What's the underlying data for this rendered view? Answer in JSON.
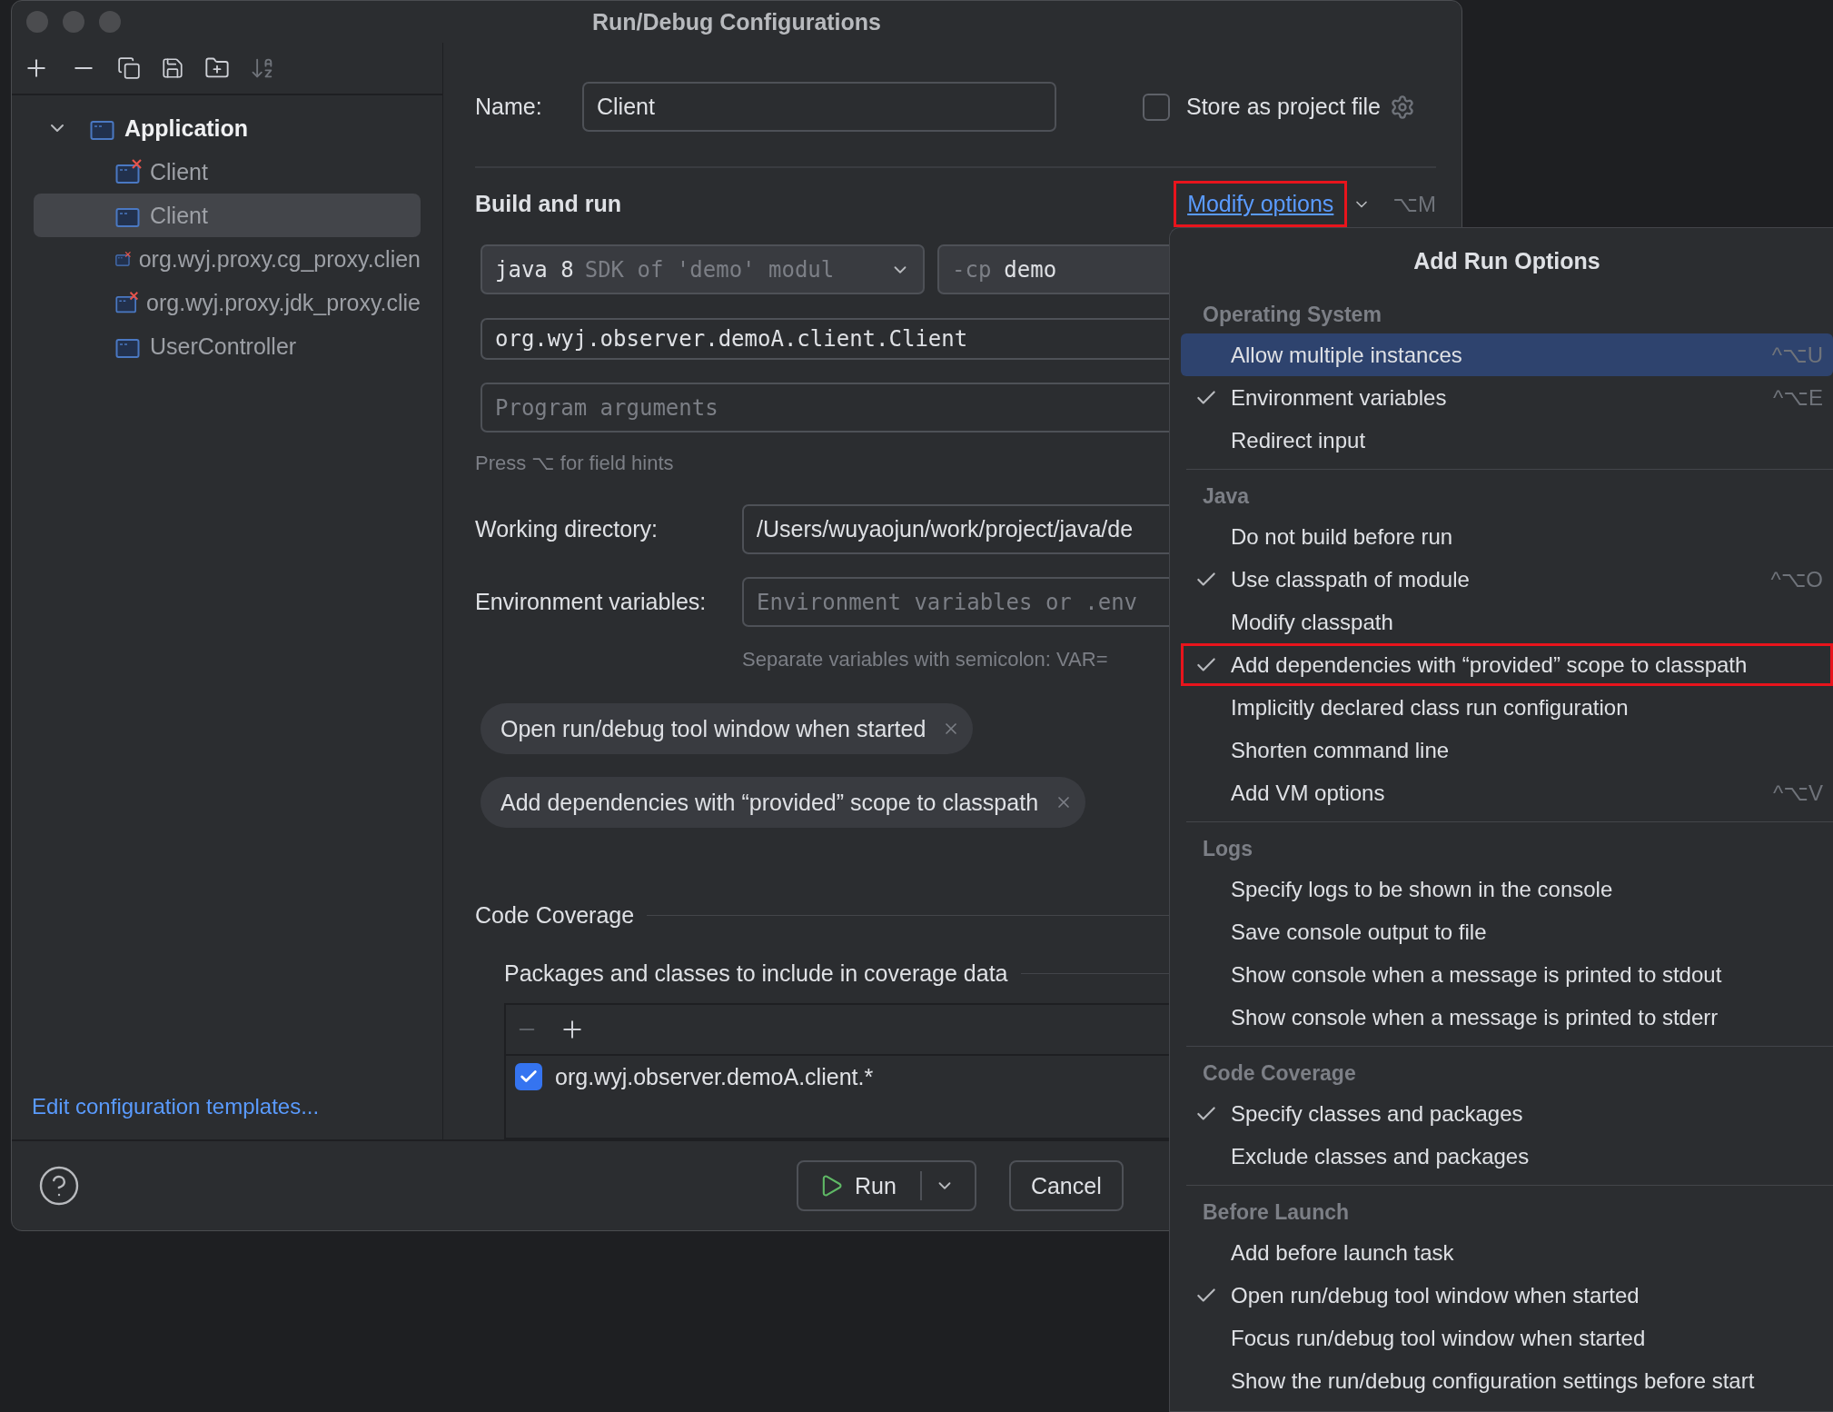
{
  "window": {
    "title": "Run/Debug Configurations"
  },
  "tree": {
    "label": "Application",
    "expanded": true,
    "children": [
      {
        "label": "Client",
        "error": true,
        "selected": false
      },
      {
        "label": "Client",
        "error": false,
        "selected": true
      },
      {
        "label": "org.wyj.proxy.cg_proxy.clien",
        "error": true,
        "selected": false
      },
      {
        "label": "org.wyj.proxy.jdk_proxy.clie",
        "error": true,
        "selected": false
      },
      {
        "label": "UserController",
        "error": false,
        "selected": false
      }
    ]
  },
  "edit_templates_link": "Edit configuration templates...",
  "form": {
    "name_label": "Name:",
    "name_value": "Client",
    "store_checkbox": {
      "label": "Store as project file",
      "checked": false
    },
    "section_title": "Build and run",
    "modify_options": {
      "label": "Modify options",
      "shortcut": "⌥M",
      "highlighted": true
    },
    "sdk": {
      "value": "java 8",
      "hint": "SDK of 'demo' modul"
    },
    "classpath": {
      "flag": "-cp",
      "value": "demo"
    },
    "main_class": "org.wyj.observer.demoA.client.Client",
    "program_args": {
      "placeholder": "Program arguments"
    },
    "field_hint": "Press ⌥ for field hints",
    "working_directory": {
      "label": "Working directory:",
      "value": "/Users/wuyaojun/work/project/java/de"
    },
    "environment": {
      "label": "Environment variables:",
      "placeholder": "Environment variables or .env",
      "hint": "Separate variables with semicolon: VAR="
    },
    "chips": [
      "Open run/debug tool window when started",
      "Add dependencies with “provided” scope to classpath"
    ],
    "coverage": {
      "title": "Code Coverage",
      "subtitle": "Packages and classes to include in coverage data",
      "entries": [
        {
          "label": "org.wyj.observer.demoA.client.*",
          "checked": true
        }
      ]
    }
  },
  "buttons": {
    "run": "Run",
    "cancel": "Cancel"
  },
  "popup": {
    "title": "Add Run Options",
    "sections": [
      {
        "title": "Operating System",
        "items": [
          {
            "label": "Allow multiple instances",
            "checked": false,
            "selected": true,
            "highlighted": false,
            "shortcut": "^⌥U"
          },
          {
            "label": "Environment variables",
            "checked": true,
            "selected": false,
            "highlighted": false,
            "shortcut": "^⌥E"
          },
          {
            "label": "Redirect input",
            "checked": false,
            "selected": false,
            "highlighted": false
          }
        ]
      },
      {
        "title": "Java",
        "items": [
          {
            "label": "Do not build before run",
            "checked": false,
            "selected": false,
            "highlighted": false
          },
          {
            "label": "Use classpath of module",
            "checked": true,
            "selected": false,
            "highlighted": false,
            "shortcut": "^⌥O"
          },
          {
            "label": "Modify classpath",
            "checked": false,
            "selected": false,
            "highlighted": false
          },
          {
            "label": "Add dependencies with “provided” scope to classpath",
            "checked": true,
            "selected": false,
            "highlighted": true
          },
          {
            "label": "Implicitly declared class run configuration",
            "checked": false,
            "selected": false,
            "highlighted": false
          },
          {
            "label": "Shorten command line",
            "checked": false,
            "selected": false,
            "highlighted": false
          },
          {
            "label": "Add VM options",
            "checked": false,
            "selected": false,
            "highlighted": false,
            "shortcut": "^⌥V"
          }
        ]
      },
      {
        "title": "Logs",
        "items": [
          {
            "label": "Specify logs to be shown in the console",
            "checked": false,
            "selected": false,
            "highlighted": false
          },
          {
            "label": "Save console output to file",
            "checked": false,
            "selected": false,
            "highlighted": false
          },
          {
            "label": "Show console when a message is printed to stdout",
            "checked": false,
            "selected": false,
            "highlighted": false
          },
          {
            "label": "Show console when a message is printed to stderr",
            "checked": false,
            "selected": false,
            "highlighted": false
          }
        ]
      },
      {
        "title": "Code Coverage",
        "items": [
          {
            "label": "Specify classes and packages",
            "checked": true,
            "selected": false,
            "highlighted": false
          },
          {
            "label": "Exclude classes and packages",
            "checked": false,
            "selected": false,
            "highlighted": false
          }
        ]
      },
      {
        "title": "Before Launch",
        "items": [
          {
            "label": "Add before launch task",
            "checked": false,
            "selected": false,
            "highlighted": false
          },
          {
            "label": "Open run/debug tool window when started",
            "checked": true,
            "selected": false,
            "highlighted": false
          },
          {
            "label": "Focus run/debug tool window when started",
            "checked": false,
            "selected": false,
            "highlighted": false
          },
          {
            "label": "Show the run/debug configuration settings before start",
            "checked": false,
            "selected": false,
            "highlighted": false
          }
        ]
      }
    ]
  }
}
